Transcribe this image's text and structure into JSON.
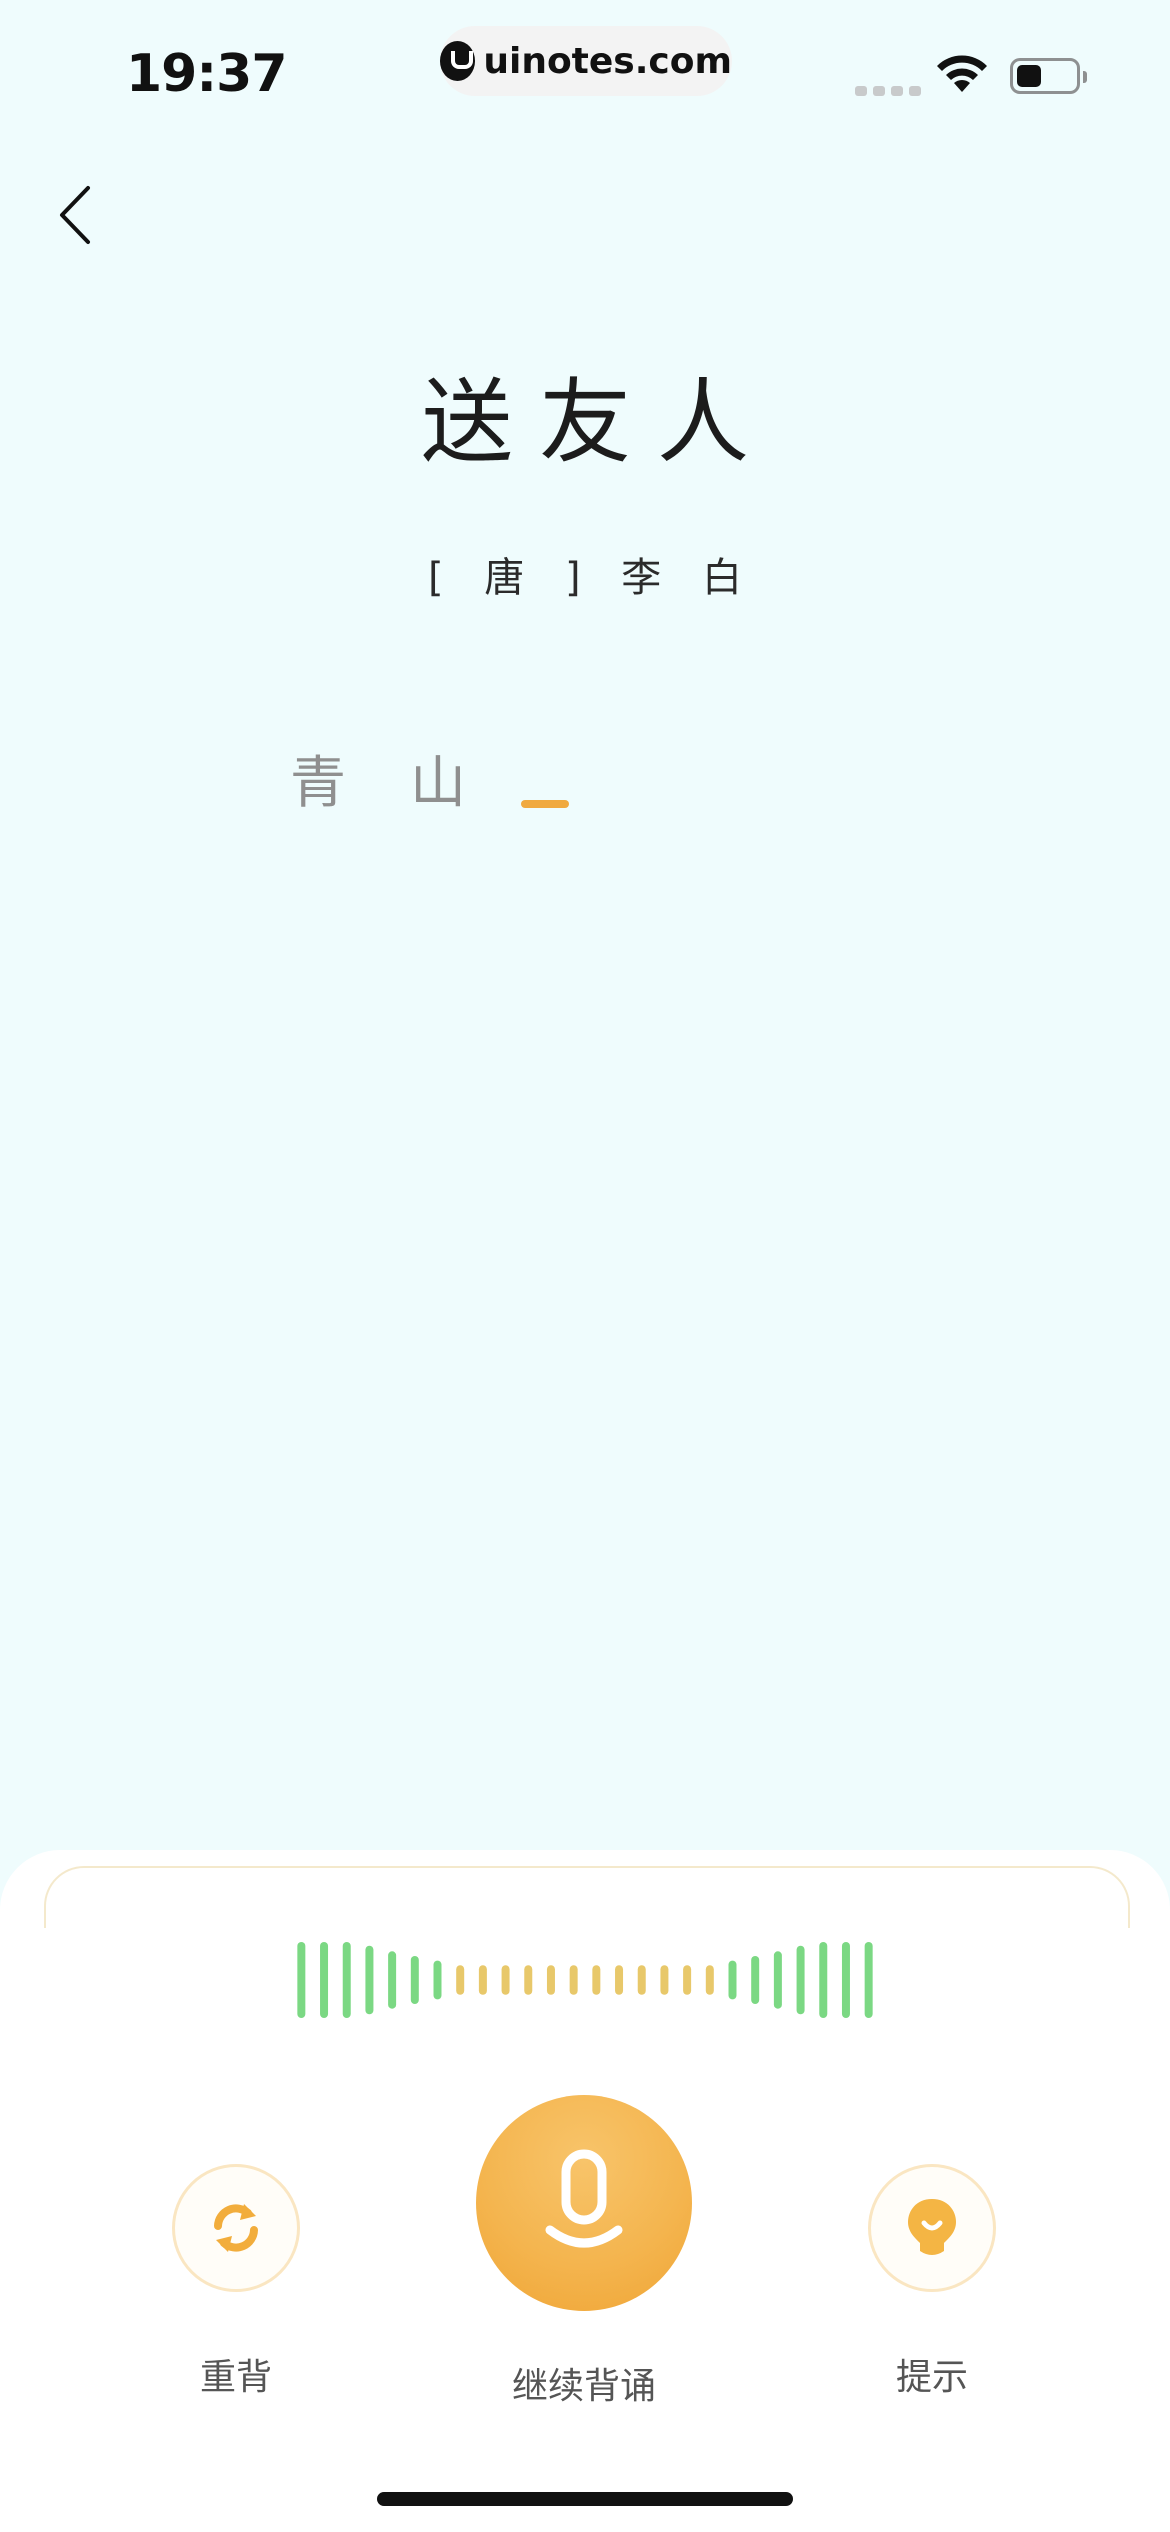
{
  "status_bar": {
    "time": "19:37",
    "url": "uinotes.com"
  },
  "poem": {
    "title": "送友人",
    "author": "[ 唐 ] 李 白",
    "recited_chars": [
      "青",
      "山"
    ]
  },
  "recorder": {
    "waveform_levels": [
      1.0,
      1.0,
      1.0,
      0.88,
      0.7,
      0.55,
      0.4,
      0.25,
      0.25,
      0.25,
      0.25,
      0.25,
      0.25,
      0.25,
      0.25,
      0.25,
      0.25,
      0.25,
      0.25,
      0.4,
      0.55,
      0.7,
      0.88,
      1.0,
      1.0,
      1.0
    ],
    "colors": {
      "active": "#7bd883",
      "quiet": "#e8c86a",
      "accent": "#f0a935"
    }
  },
  "actions": {
    "restart": {
      "label": "重背",
      "icon": "refresh-icon"
    },
    "continue": {
      "label": "继续背诵",
      "icon": "microphone-icon"
    },
    "hint": {
      "label": "提示",
      "icon": "lightbulb-icon"
    }
  }
}
